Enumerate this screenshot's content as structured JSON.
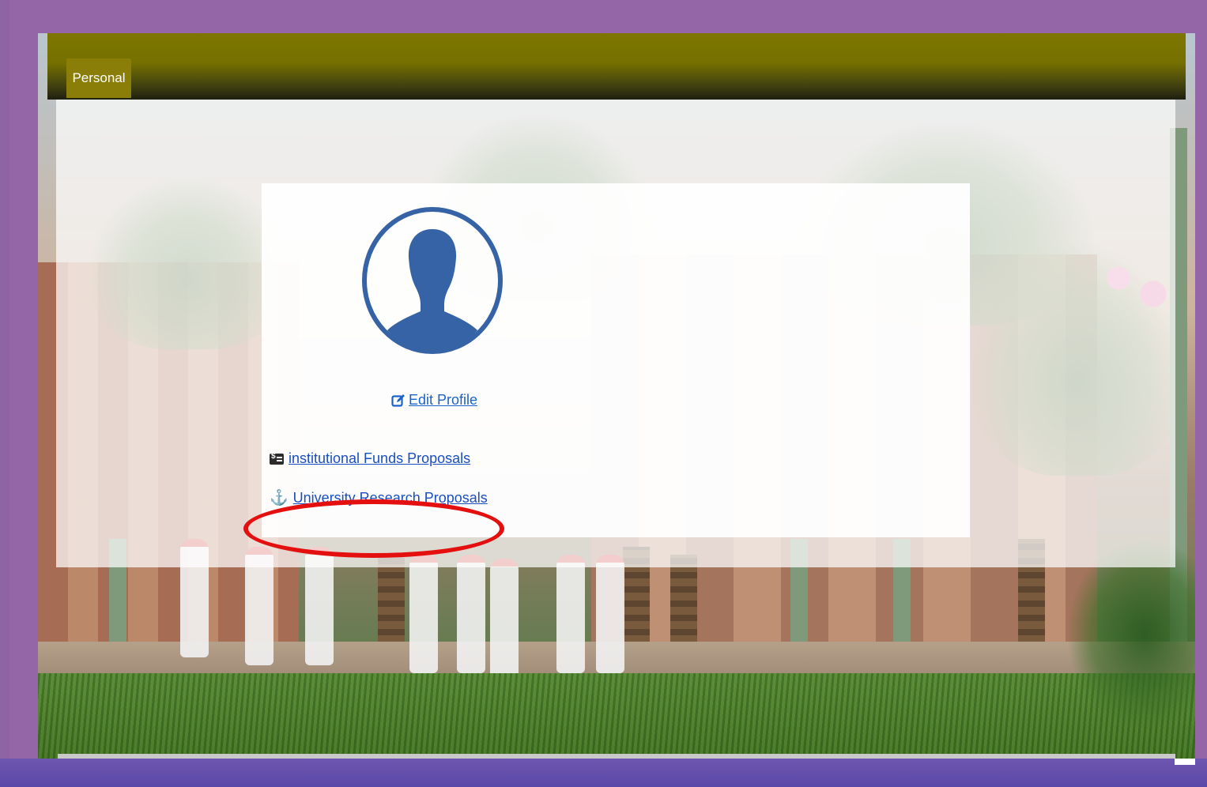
{
  "nav": {
    "tab_label": "Personal"
  },
  "profile": {
    "edit_label": " Edit Profile",
    "avatar_icon": "user-silhouette-icon"
  },
  "links": {
    "funds_label": "institutional Funds Proposals",
    "funds_icon": "money-check-icon",
    "research_label": "University Research Proposals",
    "research_icon": "anchor-icon"
  },
  "colors": {
    "page_border": "#9466a8",
    "navbar": "#7e7600",
    "link": "#1a63c9",
    "avatar": "#3563a6",
    "highlight": "#e41010"
  }
}
